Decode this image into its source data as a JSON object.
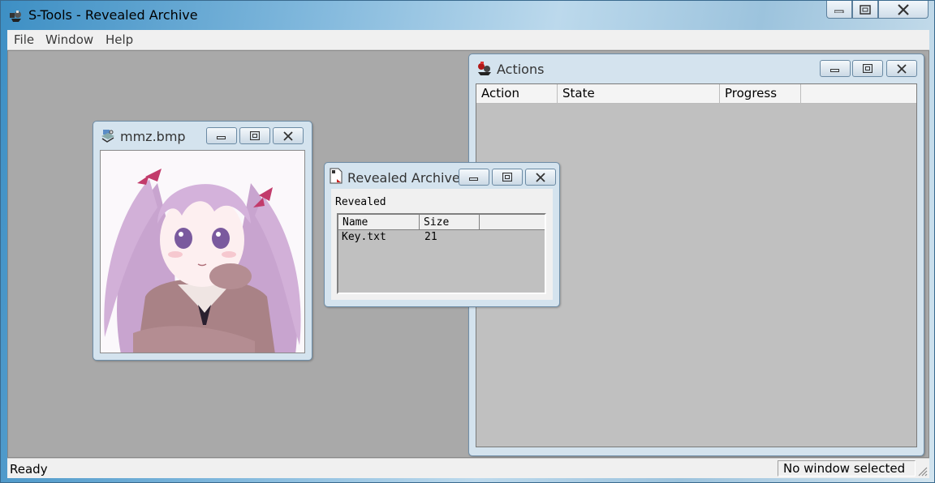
{
  "app": {
    "title": "S-Tools - Revealed Archive",
    "accent": "#3d8fc4"
  },
  "menu": [
    "File",
    "Window",
    "Help"
  ],
  "status": {
    "left": "Ready",
    "right": "No window selected"
  },
  "windows": {
    "actions": {
      "title": "Actions",
      "icon": "actions-icon",
      "columns": [
        "Action",
        "State",
        "Progress"
      ]
    },
    "image": {
      "title": "mmz.bmp",
      "icon": "image-file-icon"
    },
    "revealed": {
      "title": "Revealed Archive",
      "icon": "document-icon",
      "label": "Revealed",
      "columns": [
        "Name",
        "Size"
      ],
      "rows": [
        {
          "name": "Key.txt",
          "size": "21"
        }
      ]
    }
  }
}
